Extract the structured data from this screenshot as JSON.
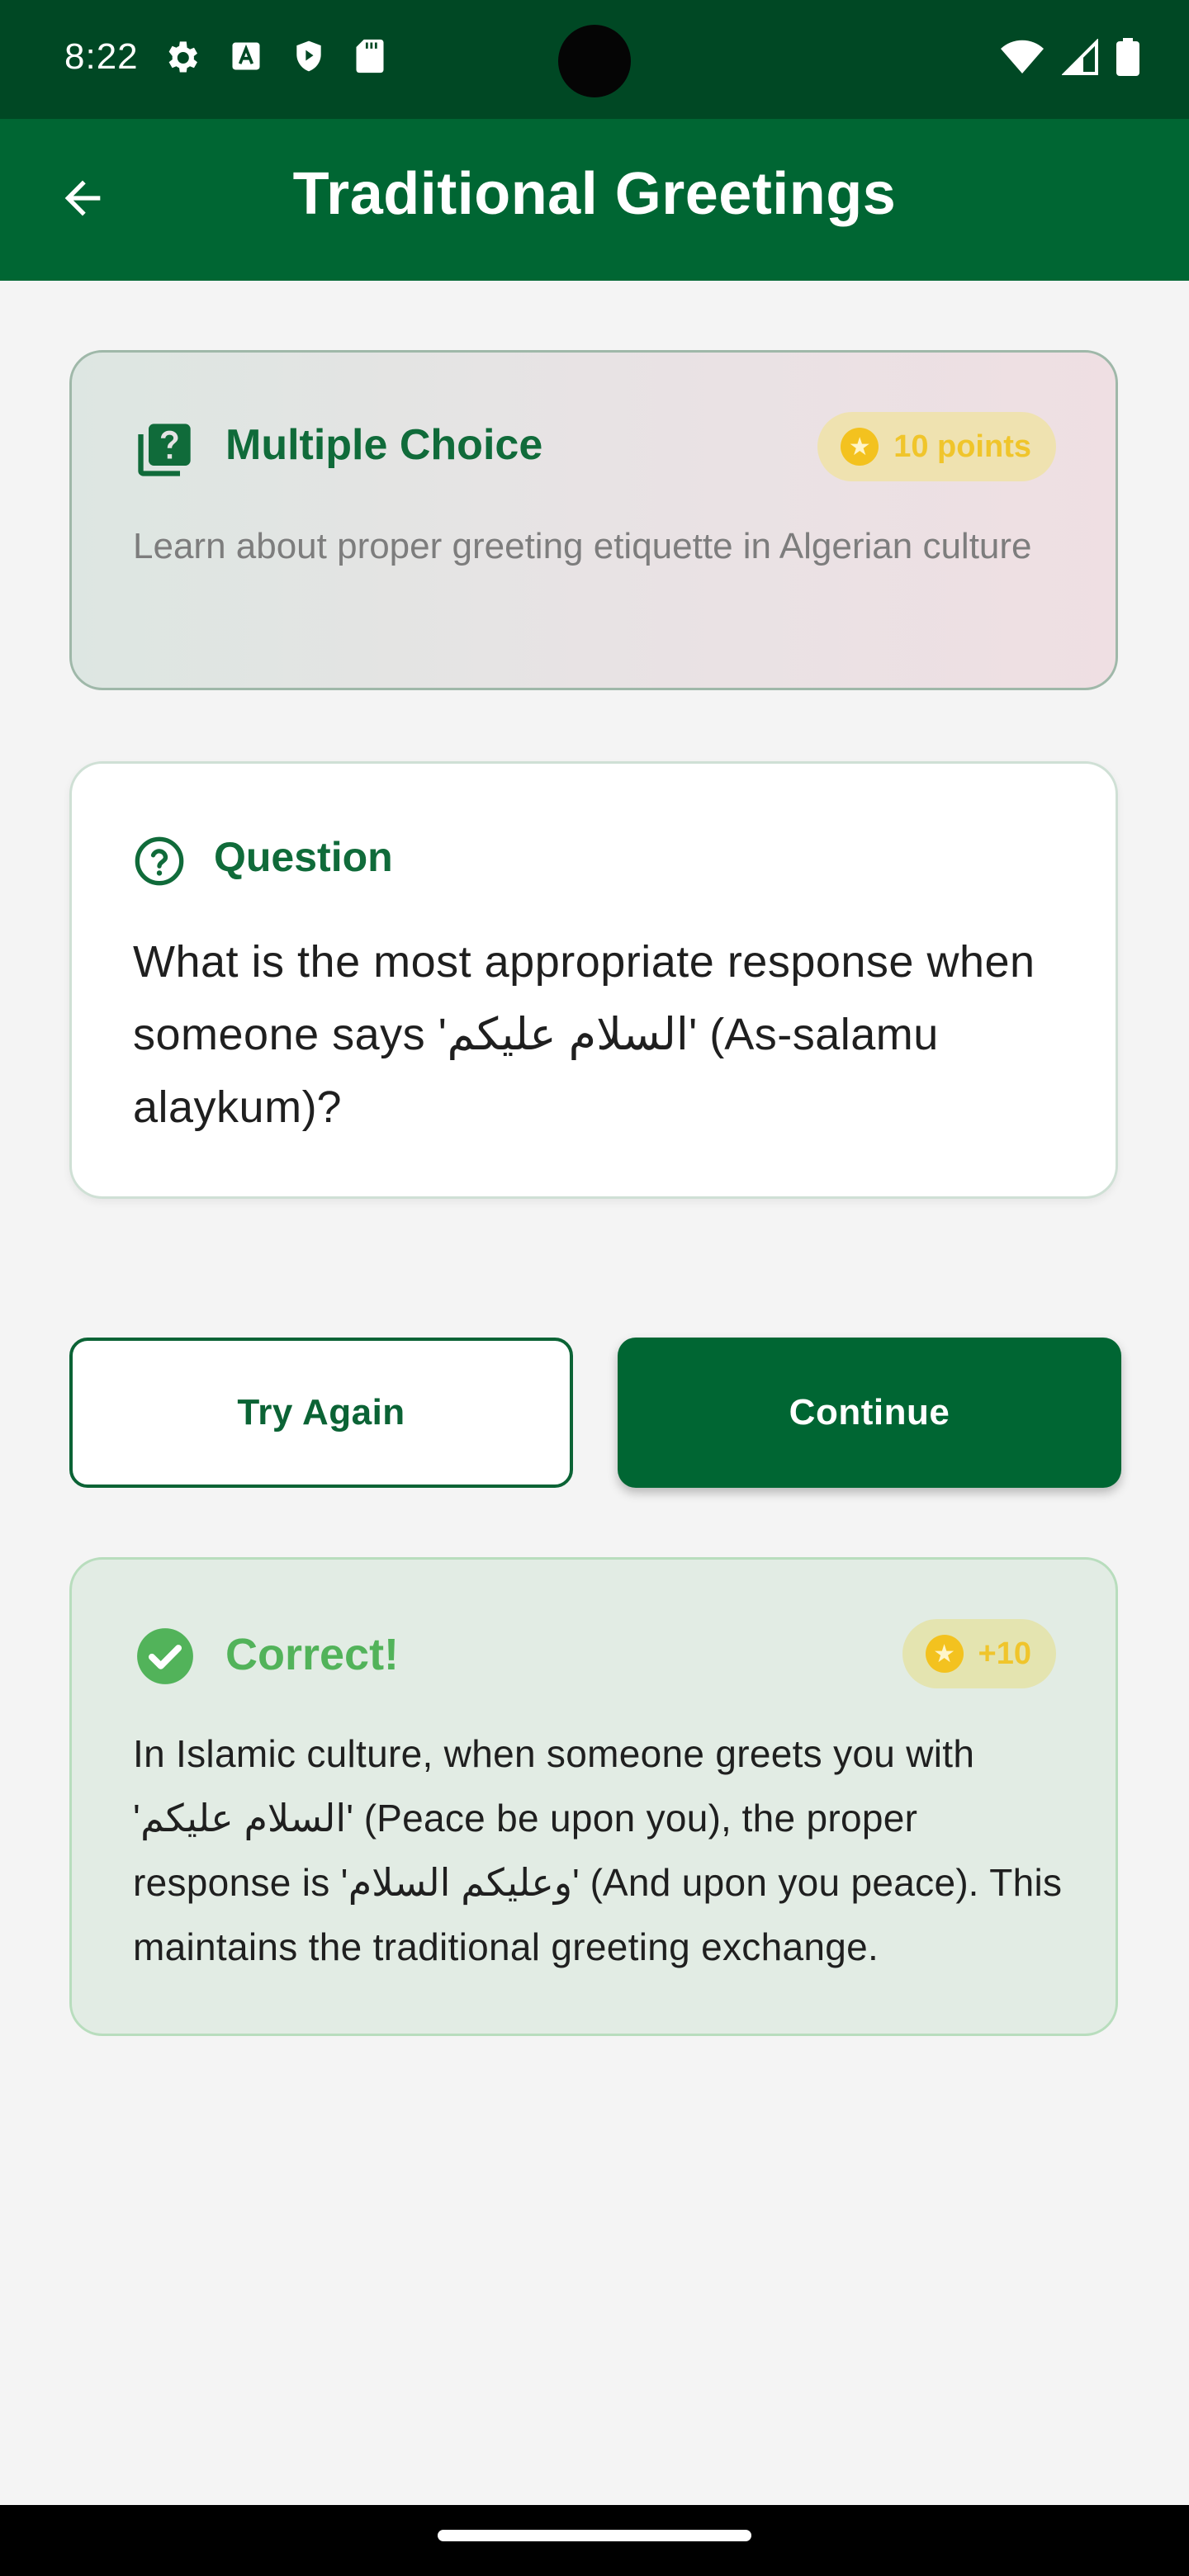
{
  "status_bar": {
    "time": "8:22",
    "left_icons": [
      "settings-icon",
      "font-icon",
      "shield-play-icon",
      "sd-card-icon"
    ],
    "right_icons": [
      "wifi-icon",
      "cell-signal-icon",
      "battery-icon"
    ]
  },
  "app_bar": {
    "title": "Traditional Greetings",
    "back_icon": "arrow-back-icon"
  },
  "exercise": {
    "type_label": "Multiple Choice",
    "type_icon": "quiz-icon",
    "points_label": "10 points",
    "description": "Learn about proper greeting etiquette in Algerian culture"
  },
  "question": {
    "label": "Question",
    "icon": "help-circle-icon",
    "text": "What is the most appropriate response when someone says 'السلام عليكم' (As-salamu alaykum)?"
  },
  "buttons": {
    "try_again": "Try Again",
    "continue": "Continue"
  },
  "result": {
    "title": "Correct!",
    "icon": "check-circle-icon",
    "points_awarded": "+10",
    "explanation": "In Islamic culture, when someone greets you with 'السلام عليكم' (Peace be upon you), the proper response is 'وعليكم السلام' (And upon you peace). This maintains the traditional greeting exchange."
  },
  "colors": {
    "primary": "#006633",
    "status_bar": "#004824",
    "accent_gold": "#f3c21f",
    "success_green": "#52b35a"
  }
}
